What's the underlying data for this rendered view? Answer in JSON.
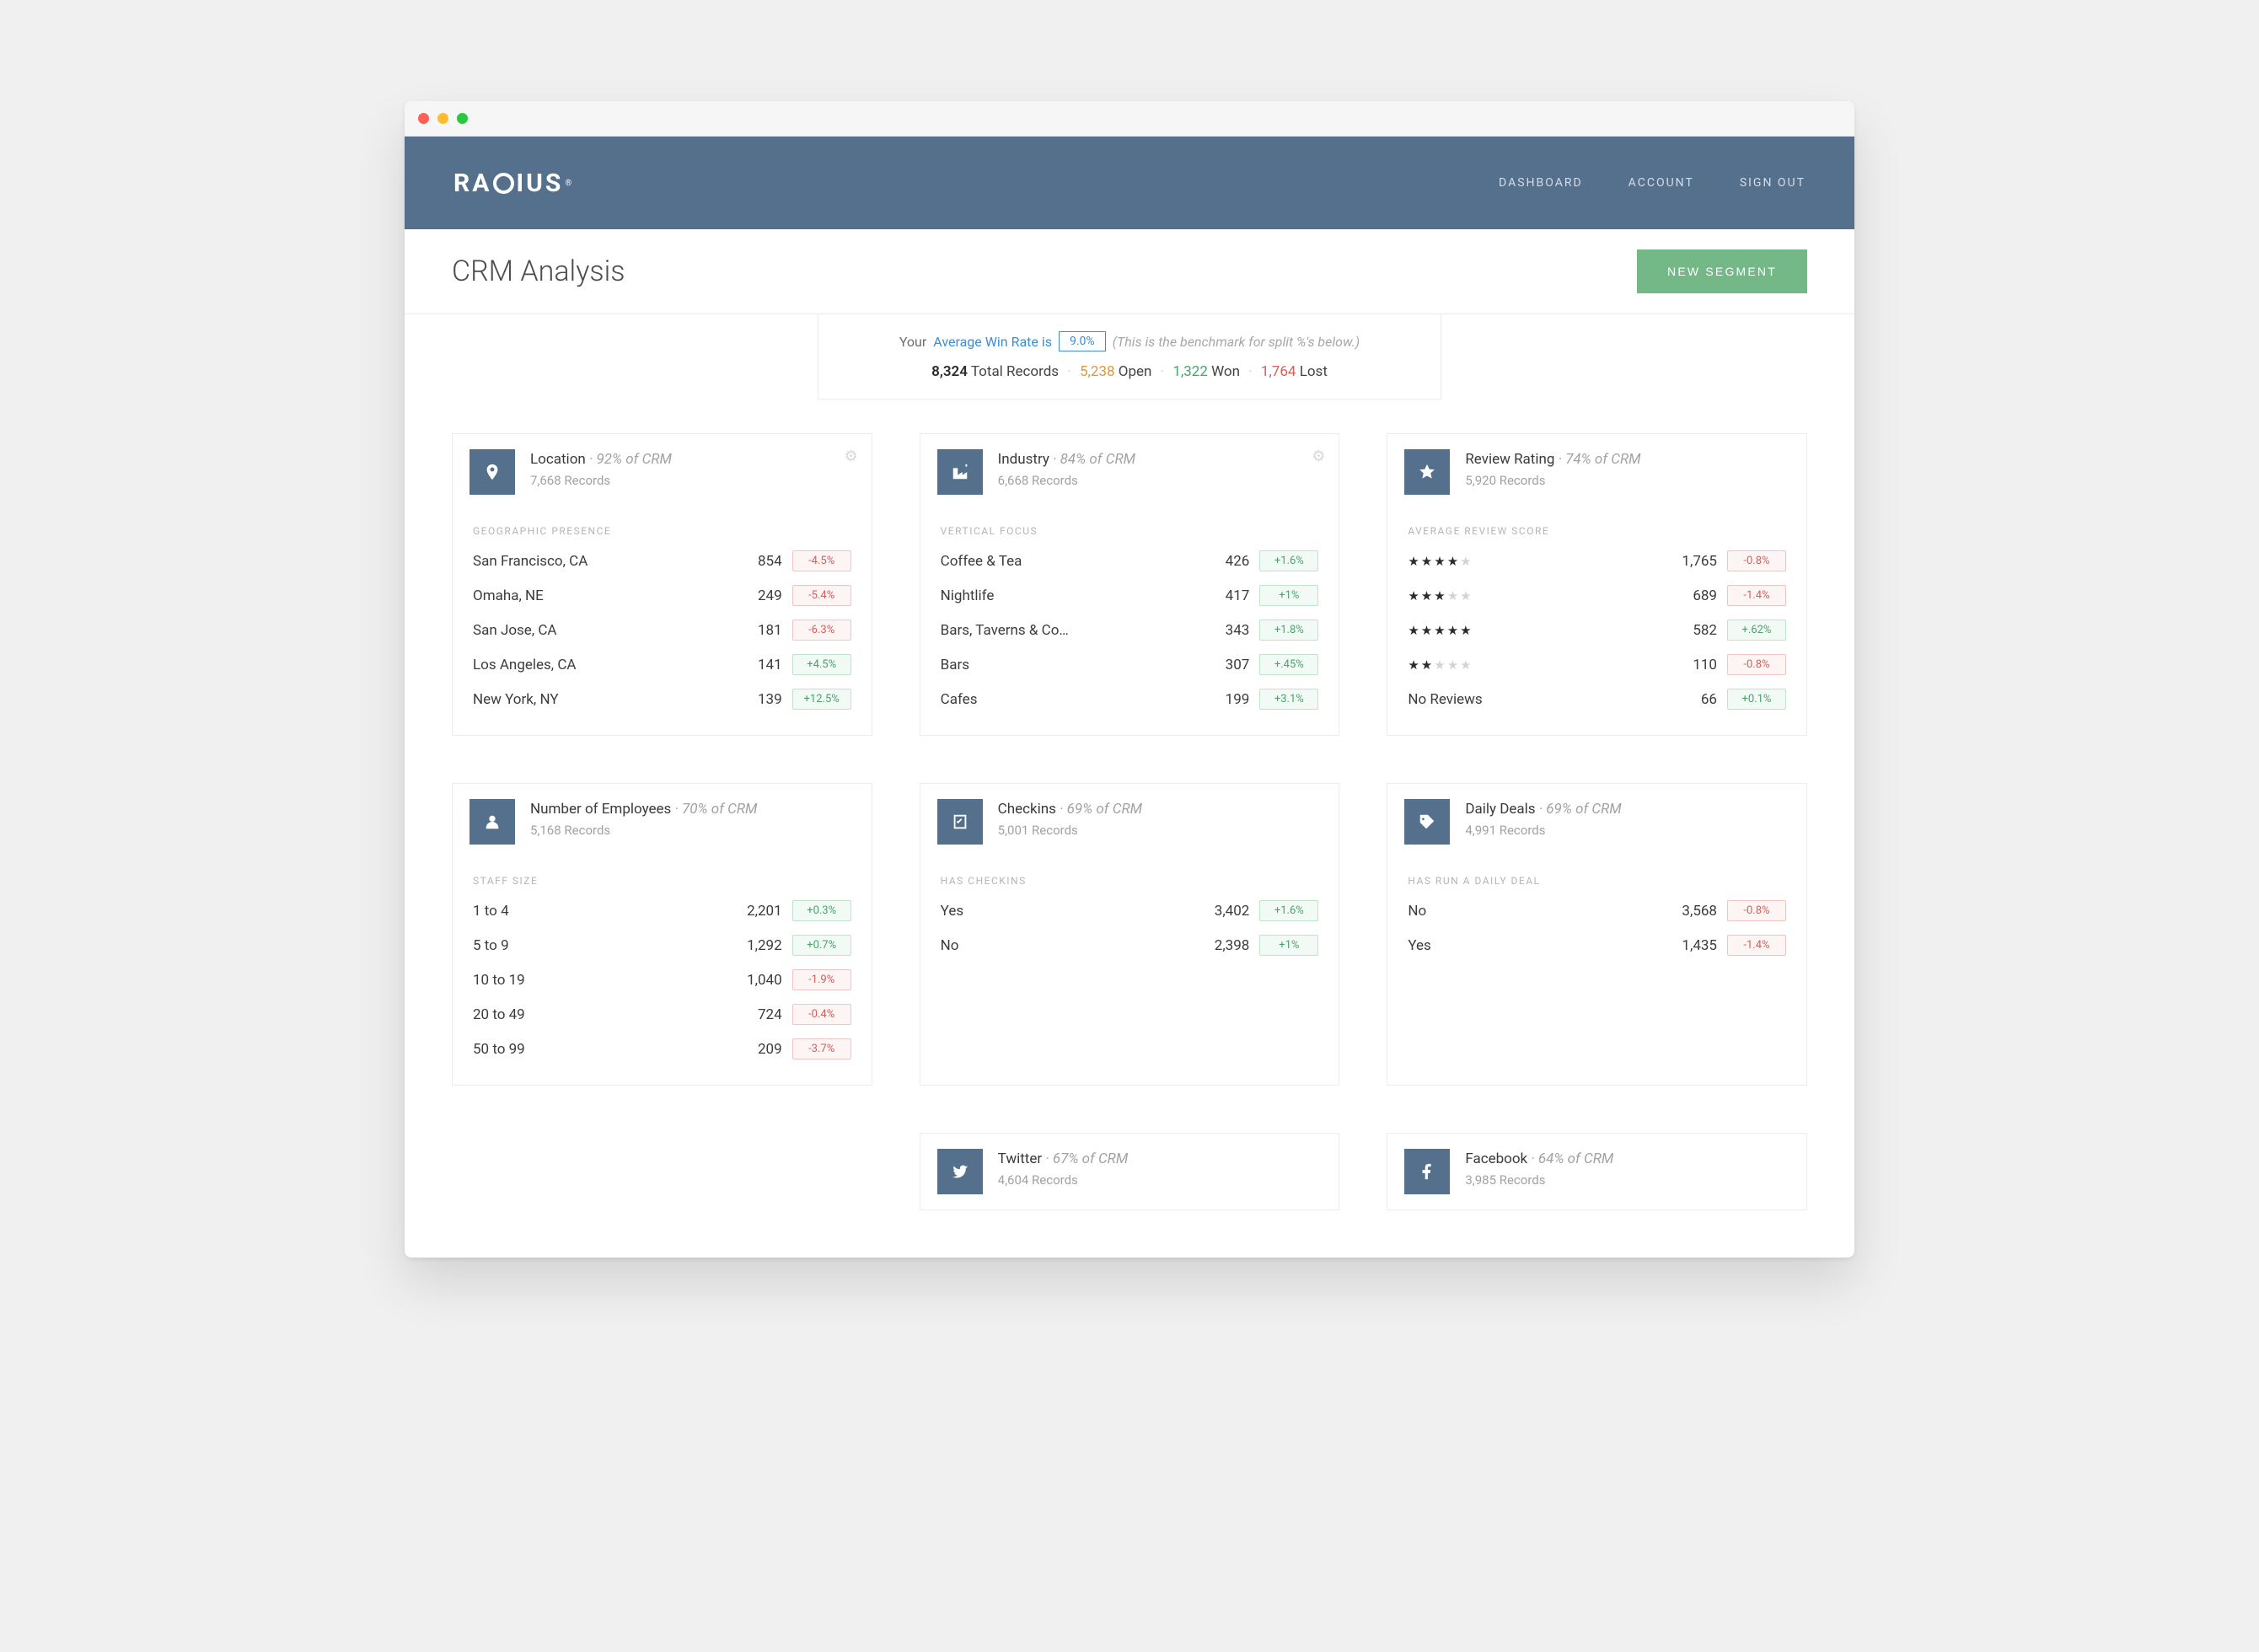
{
  "brand": {
    "name": "RADIUS"
  },
  "nav": {
    "dashboard": "DASHBOARD",
    "account": "ACCOUNT",
    "signout": "SIGN OUT"
  },
  "page": {
    "title": "CRM Analysis",
    "new_segment": "NEW SEGMENT"
  },
  "benchmark": {
    "prefix": "Your",
    "link": "Average Win Rate is",
    "rate": "9.0%",
    "note": "(This is the benchmark for split %'s below.)",
    "total_n": "8,324",
    "total_l": "Total Records",
    "open_n": "5,238",
    "open_l": "Open",
    "won_n": "1,322",
    "won_l": "Won",
    "lost_n": "1,764",
    "lost_l": "Lost"
  },
  "cards": [
    {
      "id": "location",
      "icon": "pin",
      "title": "Location",
      "coverage": "92% of CRM",
      "records": "7,668 Records",
      "gear": true,
      "section": "GEOGRAPHIC PRESENCE",
      "rows": [
        {
          "label": "San Francisco, CA",
          "value": "854",
          "delta": "-4.5%",
          "dir": "neg"
        },
        {
          "label": "Omaha, NE",
          "value": "249",
          "delta": "-5.4%",
          "dir": "neg"
        },
        {
          "label": "San Jose, CA",
          "value": "181",
          "delta": "-6.3%",
          "dir": "neg"
        },
        {
          "label": "Los Angeles, CA",
          "value": "141",
          "delta": "+4.5%",
          "dir": "pos"
        },
        {
          "label": "New York, NY",
          "value": "139",
          "delta": "+12.5%",
          "dir": "pos"
        }
      ]
    },
    {
      "id": "industry",
      "icon": "factory",
      "title": "Industry",
      "coverage": "84% of CRM",
      "records": "6,668 Records",
      "gear": true,
      "section": "VERTICAL FOCUS",
      "rows": [
        {
          "label": "Coffee & Tea",
          "value": "426",
          "delta": "+1.6%",
          "dir": "pos"
        },
        {
          "label": "Nightlife",
          "value": "417",
          "delta": "+1%",
          "dir": "pos"
        },
        {
          "label": "Bars, Taverns & Co…",
          "value": "343",
          "delta": "+1.8%",
          "dir": "pos"
        },
        {
          "label": "Bars",
          "value": "307",
          "delta": "+.45%",
          "dir": "pos"
        },
        {
          "label": "Cafes",
          "value": "199",
          "delta": "+3.1%",
          "dir": "pos"
        }
      ]
    },
    {
      "id": "review",
      "icon": "star",
      "title": "Review Rating",
      "coverage": "74% of CRM",
      "records": "5,920 Records",
      "section": "AVERAGE REVIEW SCORE",
      "rows": [
        {
          "label": "★★★★",
          "stars": 4,
          "value": "1,765",
          "delta": "-0.8%",
          "dir": "neg"
        },
        {
          "label": "★★★",
          "stars": 3,
          "value": "689",
          "delta": "-1.4%",
          "dir": "neg"
        },
        {
          "label": "★★★★★",
          "stars": 5,
          "value": "582",
          "delta": "+.62%",
          "dir": "pos"
        },
        {
          "label": "★★",
          "stars": 2,
          "value": "110",
          "delta": "-0.8%",
          "dir": "neg"
        },
        {
          "label": "No Reviews",
          "value": "66",
          "delta": "+0.1%",
          "dir": "pos"
        }
      ]
    },
    {
      "id": "employees",
      "icon": "people",
      "title": "Number of Employees",
      "coverage": "70% of CRM",
      "records": "5,168 Records",
      "section": "STAFF SIZE",
      "rows": [
        {
          "label": "1 to 4",
          "value": "2,201",
          "delta": "+0.3%",
          "dir": "pos"
        },
        {
          "label": "5 to 9",
          "value": "1,292",
          "delta": "+0.7%",
          "dir": "pos"
        },
        {
          "label": "10 to 19",
          "value": "1,040",
          "delta": "-1.9%",
          "dir": "neg"
        },
        {
          "label": "20 to 49",
          "value": "724",
          "delta": "-0.4%",
          "dir": "neg"
        },
        {
          "label": "50 to 99",
          "value": "209",
          "delta": "-3.7%",
          "dir": "neg"
        }
      ]
    },
    {
      "id": "checkins",
      "icon": "check",
      "title": "Checkins",
      "coverage": "69% of CRM",
      "records": "5,001 Records",
      "section": "HAS CHECKINS",
      "rows": [
        {
          "label": "Yes",
          "value": "3,402",
          "delta": "+1.6%",
          "dir": "pos"
        },
        {
          "label": "No",
          "value": "2,398",
          "delta": "+1%",
          "dir": "pos"
        }
      ]
    },
    {
      "id": "deals",
      "icon": "tag",
      "title": "Daily Deals",
      "coverage": "69% of CRM",
      "records": "4,991 Records",
      "section": "HAS RUN A DAILY DEAL",
      "rows": [
        {
          "label": "No",
          "value": "3,568",
          "delta": "-0.8%",
          "dir": "neg"
        },
        {
          "label": "Yes",
          "value": "1,435",
          "delta": "-1.4%",
          "dir": "neg"
        }
      ]
    },
    {
      "id": "twitter",
      "icon": "twitter",
      "title": "Twitter",
      "coverage": "67% of CRM",
      "records": "4,604 Records",
      "norows": true
    },
    {
      "id": "facebook",
      "icon": "facebook",
      "title": "Facebook",
      "coverage": "64% of CRM",
      "records": "3,985 Records",
      "norows": true
    }
  ]
}
